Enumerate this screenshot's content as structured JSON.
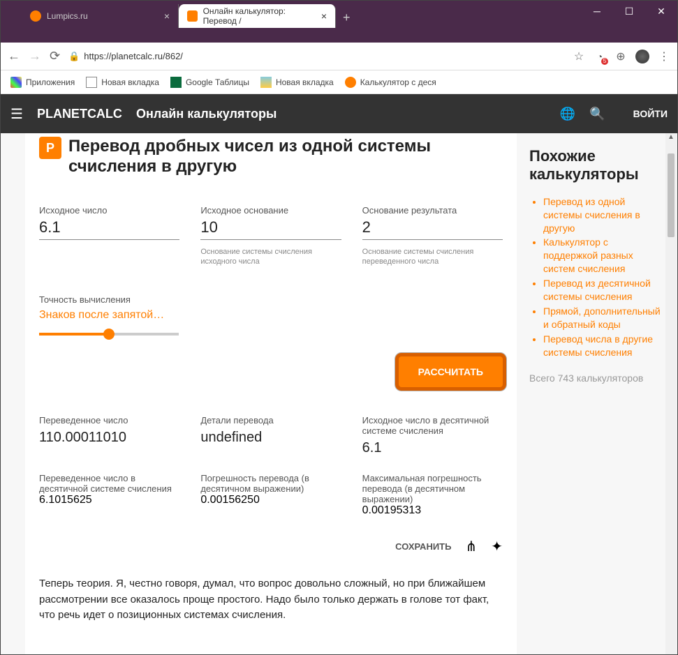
{
  "window": {
    "tabs": [
      {
        "title": "Lumpics.ru"
      },
      {
        "title": "Онлайн калькулятор: Перевод /"
      }
    ]
  },
  "browser": {
    "url": "https://planetcalc.ru/862/",
    "bookmarks": [
      {
        "label": "Приложения"
      },
      {
        "label": "Новая вкладка"
      },
      {
        "label": "Google Таблицы"
      },
      {
        "label": "Новая вкладка"
      },
      {
        "label": "Калькулятор с деся"
      }
    ]
  },
  "header": {
    "brand": "PLANETCALC",
    "subtitle": "Онлайн калькуляторы",
    "login": "ВОЙТИ"
  },
  "page": {
    "title": "Перевод дробных чисел из одной системы счисления в другую",
    "inputs": {
      "source_number": {
        "label": "Исходное число",
        "value": "6.1"
      },
      "source_base": {
        "label": "Исходное основание",
        "value": "10",
        "helper": "Основание системы счисления исходного числа"
      },
      "target_base": {
        "label": "Основание результата",
        "value": "2",
        "helper": "Основание системы счисления переведенного числа"
      }
    },
    "precision": {
      "label": "Точность вычисления",
      "text": "Знаков после запятой…"
    },
    "calc_button": "РАССЧИТАТЬ",
    "results": {
      "converted": {
        "label": "Переведенное число",
        "value": "110.00011010"
      },
      "details": {
        "label": "Детали перевода",
        "value": "undefined"
      },
      "source_dec": {
        "label": "Исходное число в десятичной системе счисления",
        "value": "6.1"
      },
      "converted_dec": {
        "label": "Переведенное число в десятичной системе счисления",
        "value": "6.1015625"
      },
      "error": {
        "label": "Погрешность перевода (в десятичном выражении)",
        "value": "0.00156250"
      },
      "max_error": {
        "label": "Максимальная погрешность перевода (в десятичном выражении)",
        "value": "0.00195313"
      }
    },
    "save": "СОХРАНИТЬ",
    "theory": "Теперь теория. Я, честно говоря, думал, что вопрос довольно сложный, но при ближайшем рассмотрении все оказалось проще простого. Надо было только держать в голове тот факт, что речь идет о позиционных системах счисления."
  },
  "sidebar": {
    "title": "Похожие калькуляторы",
    "items": [
      "Перевод из одной системы счисления в другую",
      "Калькулятор с поддержкой разных систем счисления",
      "Перевод из десятичной системы счисления",
      "Прямой, дополнительный и обратный коды",
      "Перевод числа в другие системы счисления"
    ],
    "note": "Всего 743 калькуляторов"
  }
}
